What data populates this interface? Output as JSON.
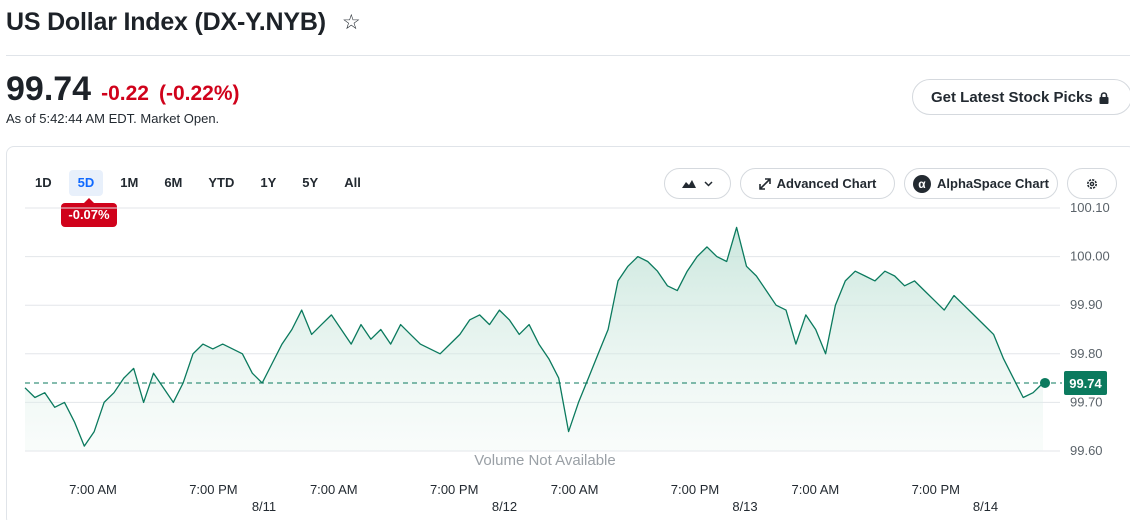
{
  "header": {
    "title": "US Dollar Index (DX-Y.NYB)",
    "star_icon": "star-icon"
  },
  "quote": {
    "price": "99.74",
    "change": "-0.22",
    "change_percent": "(-0.22%)",
    "as_of": "As of 5:42:44 AM EDT. Market Open.",
    "change_color": "#d0021b"
  },
  "picks_button": {
    "label": "Get Latest Stock Picks",
    "icon": "lock-icon"
  },
  "toolbar": {
    "ranges": [
      "1D",
      "5D",
      "1M",
      "6M",
      "YTD",
      "1Y",
      "5Y",
      "All"
    ],
    "active_range": "5D",
    "range_change": "-0.07%",
    "chart_type_icon": "mountain-icon",
    "advanced_chart_label": "Advanced Chart",
    "alphaspace_label": "AlphaSpace Chart",
    "settings_icon": "gear-icon"
  },
  "chart_data": {
    "type": "area",
    "y_ticks": [
      "100.10",
      "100.00",
      "99.90",
      "99.80",
      "99.70",
      "99.60"
    ],
    "ylim": [
      99.6,
      100.1
    ],
    "x_tick_labels": [
      "7:00 AM",
      "7:00 PM",
      "7:00 AM",
      "7:00 PM",
      "7:00 AM",
      "7:00 PM",
      "7:00 AM",
      "7:00 PM"
    ],
    "date_labels": [
      "8/11",
      "8/12",
      "8/13",
      "8/14"
    ],
    "current_value": 99.74,
    "current_value_label": "99.74",
    "volume_note": "Volume Not Available",
    "line_color": "#0b7a5e",
    "series": [
      {
        "values": [
          99.73,
          99.71,
          99.72,
          99.69,
          99.7,
          99.66,
          99.61,
          99.64,
          99.7,
          99.72,
          99.75,
          99.77,
          99.7,
          99.76,
          99.73,
          99.7,
          99.74,
          99.8,
          99.82,
          99.81,
          99.82,
          99.81,
          99.8,
          99.76,
          99.74,
          99.78,
          99.82,
          99.85,
          99.89,
          99.84,
          99.86,
          99.88,
          99.85,
          99.82,
          99.86,
          99.83,
          99.85,
          99.82,
          99.86,
          99.84,
          99.82,
          99.81,
          99.8,
          99.82,
          99.84,
          99.87,
          99.88,
          99.86,
          99.89,
          99.87,
          99.84,
          99.86,
          99.82,
          99.79,
          99.75,
          99.64,
          99.7,
          99.75,
          99.8,
          99.85,
          99.95,
          99.98,
          100.0,
          99.99,
          99.97,
          99.94,
          99.93,
          99.97,
          100.0,
          100.02,
          100.0,
          99.99,
          100.06,
          99.98,
          99.96,
          99.93,
          99.9,
          99.89,
          99.82,
          99.88,
          99.85,
          99.8,
          99.9,
          99.95,
          99.97,
          99.96,
          99.95,
          99.97,
          99.96,
          99.94,
          99.95,
          99.93,
          99.91,
          99.89,
          99.92,
          99.9,
          99.88,
          99.86,
          99.84,
          99.79,
          99.75,
          99.71,
          99.72,
          99.74
        ]
      }
    ]
  }
}
